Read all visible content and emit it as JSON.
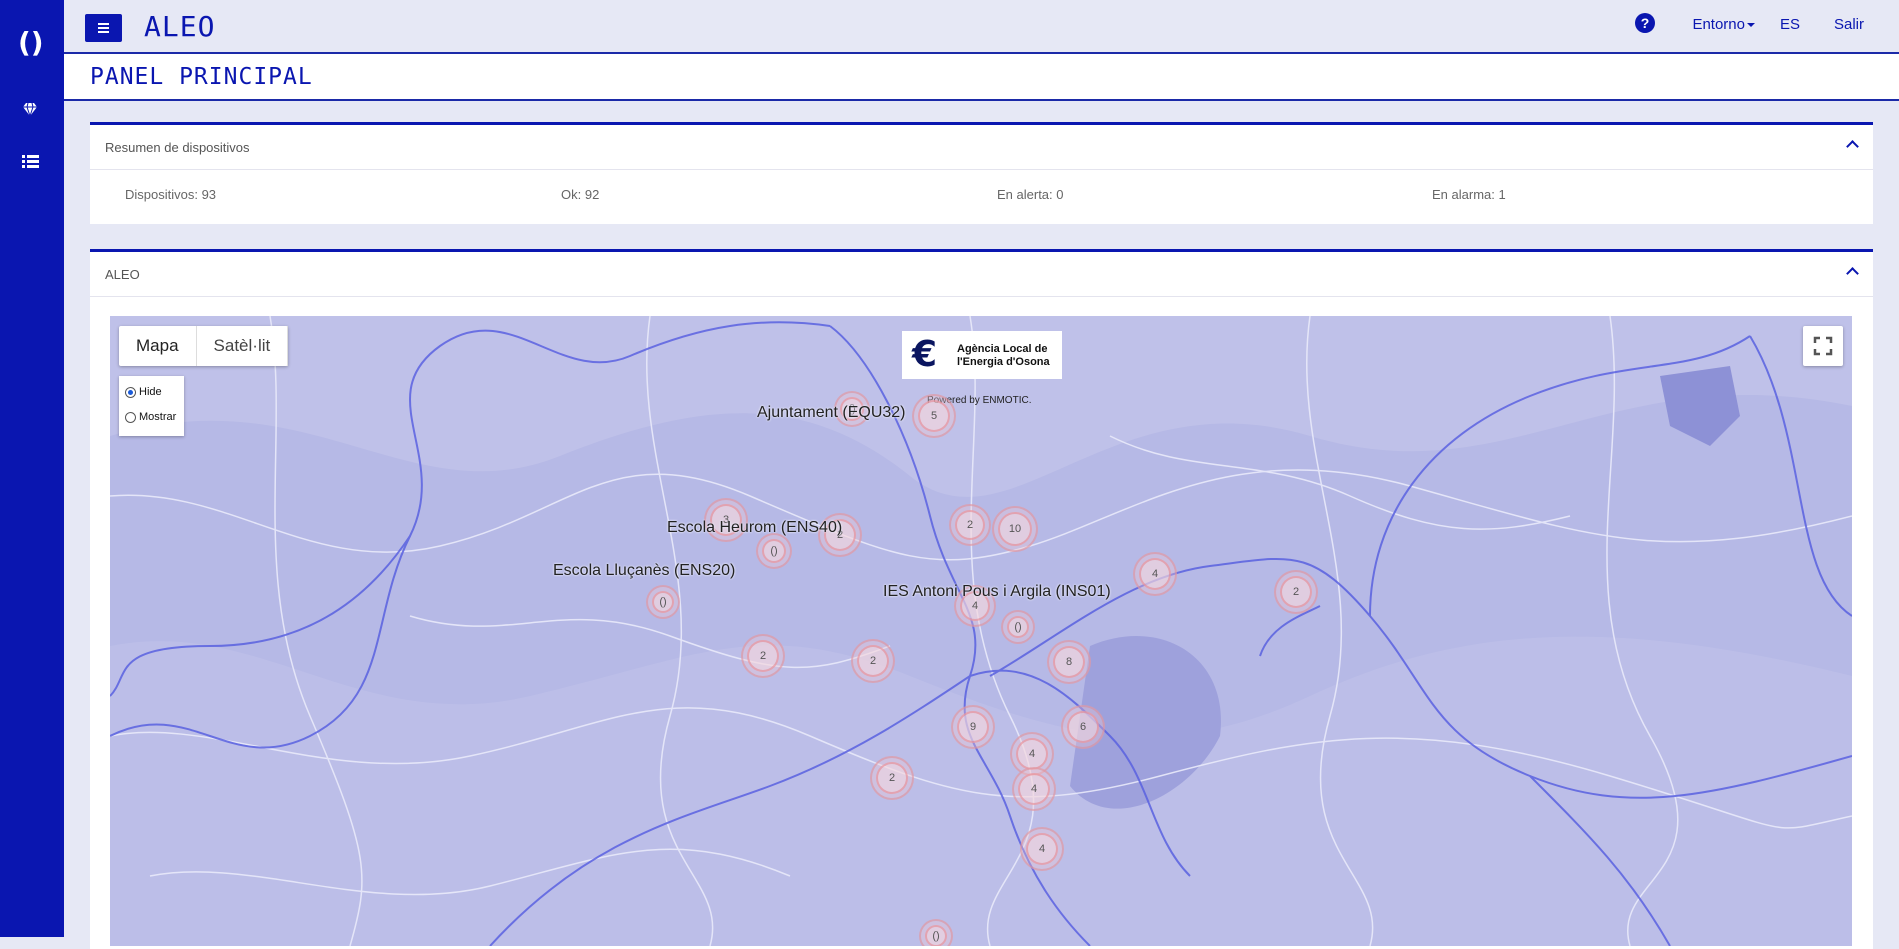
{
  "app": {
    "title": "ALEO"
  },
  "topbar": {
    "environment": "Entorno",
    "language": "ES",
    "logout": "Salir"
  },
  "page": {
    "title": "PANEL PRINCIPAL"
  },
  "summary": {
    "title": "Resumen de dispositivos",
    "devices": "Dispositivos: 93",
    "ok": "Ok:  92",
    "alert": "En alerta: 0",
    "alarm": "En alarma:  1"
  },
  "map_panel": {
    "title": "ALEO",
    "map_type_map": "Mapa",
    "map_type_satellite": "Satèl·lit",
    "radio_hide": "Hide",
    "radio_show": "Mostrar",
    "brand_line1": "Agència Local de",
    "brand_line2": "l'Energia d'Osona",
    "brand_powered": "Powered by ENMOTIC.",
    "labels": [
      "Ajuntament (EQU32)",
      "Escola Heurom (ENS40)",
      "Escola Lluçanès (ENS20)",
      "IES Antoni Pous i Argila (INS01)"
    ],
    "clusters": [
      "5",
      "3",
      "2",
      "2",
      "10",
      "4",
      "2",
      "4",
      "2",
      "2",
      "8",
      "9",
      "6",
      "4",
      "2",
      "4",
      "4"
    ]
  },
  "colors": {
    "primary": "#0a16b0",
    "background": "#e6e8f5",
    "map_water": "#5a62e0"
  }
}
